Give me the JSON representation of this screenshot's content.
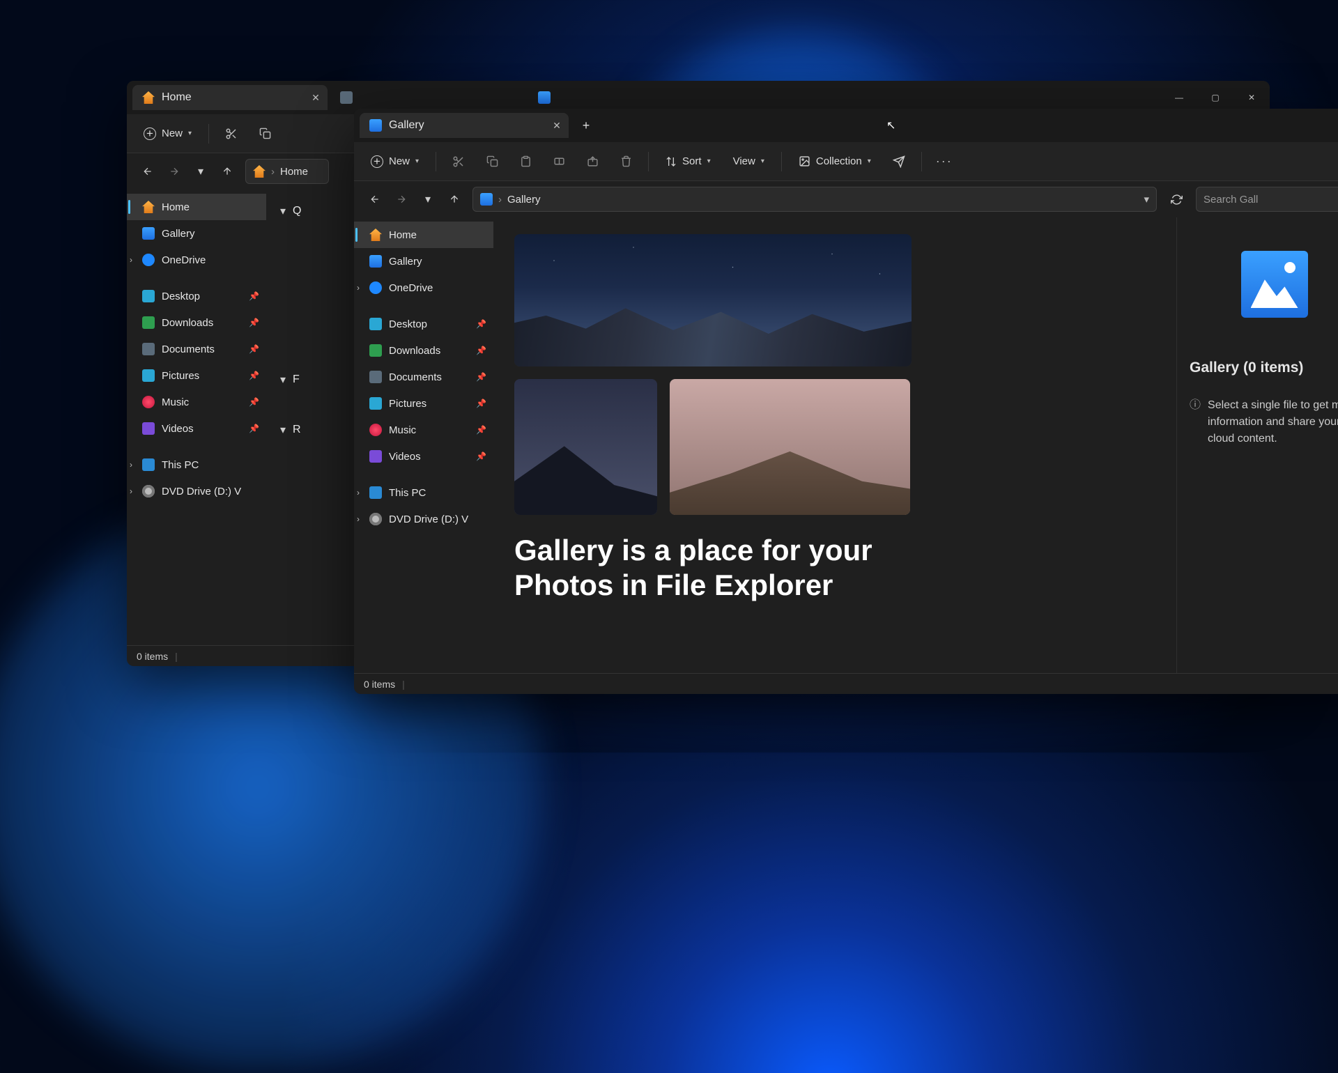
{
  "back_window": {
    "tab_title": "Home",
    "toolbar": {
      "new": "New"
    },
    "breadcrumb": "Home",
    "nav": {
      "home": "Home",
      "gallery": "Gallery",
      "onedrive": "OneDrive",
      "desktop": "Desktop",
      "downloads": "Downloads",
      "documents": "Documents",
      "pictures": "Pictures",
      "music": "Music",
      "videos": "Videos",
      "thispc": "This PC",
      "dvd": "DVD Drive (D:) V"
    },
    "sections": {
      "quick": "Q",
      "fav": "F",
      "recent": "R"
    },
    "status": "0 items"
  },
  "front_window": {
    "tab_title": "Gallery",
    "toolbar": {
      "new": "New",
      "sort": "Sort",
      "view": "View",
      "collection": "Collection"
    },
    "breadcrumb": "Gallery",
    "search_placeholder": "Search Gall",
    "nav": {
      "home": "Home",
      "gallery": "Gallery",
      "onedrive": "OneDrive",
      "desktop": "Desktop",
      "downloads": "Downloads",
      "documents": "Documents",
      "pictures": "Pictures",
      "music": "Music",
      "videos": "Videos",
      "thispc": "This PC",
      "dvd": "DVD Drive (D:) V"
    },
    "headline": "Gallery is a place for your Photos in File Explorer",
    "details": {
      "title": "Gallery (0 items)",
      "hint": "Select a single file to get more information and share your cloud content."
    },
    "status": "0 items"
  }
}
